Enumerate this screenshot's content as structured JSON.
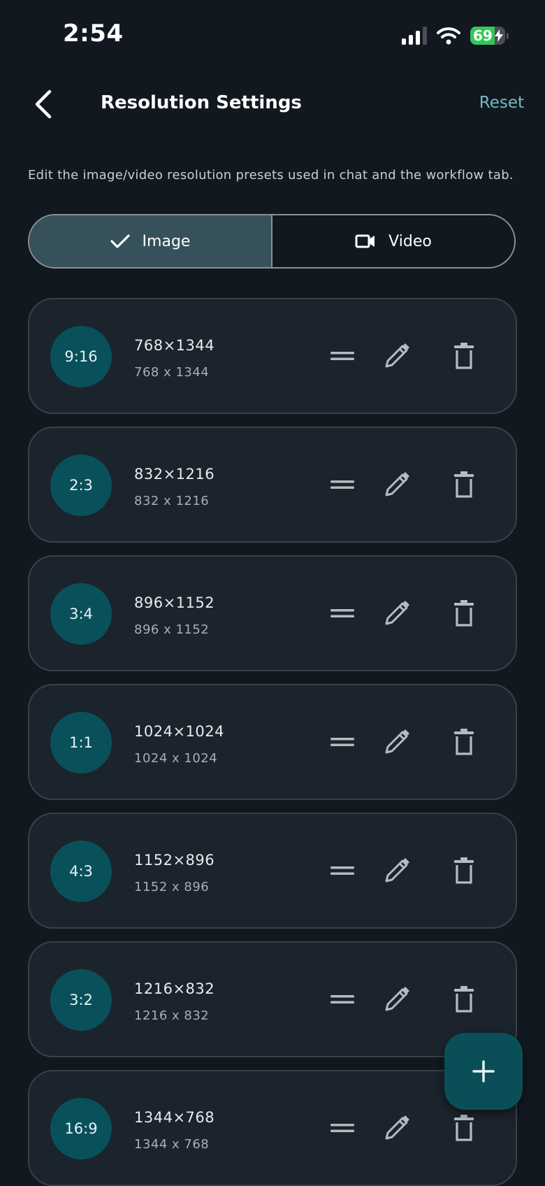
{
  "status_bar": {
    "time": "2:54",
    "battery": "69",
    "battery_level": 0.69,
    "battery_color": "#34c759"
  },
  "header": {
    "title": "Resolution Settings",
    "reset_label": "Reset",
    "back_icon": "chevron-left-icon"
  },
  "description": "Edit the image/video resolution presets used in chat and the workflow tab.",
  "tabs": [
    {
      "label": "Image",
      "icon": "check-icon",
      "selected": true
    },
    {
      "label": "Video",
      "icon": "video-camera-icon",
      "selected": false
    }
  ],
  "presets": [
    {
      "ratio": "9:16",
      "name": "768×1344",
      "size": "768 x 1344"
    },
    {
      "ratio": "2:3",
      "name": "832×1216",
      "size": "832 x 1216"
    },
    {
      "ratio": "3:4",
      "name": "896×1152",
      "size": "896 x 1152"
    },
    {
      "ratio": "1:1",
      "name": "1024×1024",
      "size": "1024 x 1024"
    },
    {
      "ratio": "4:3",
      "name": "1152×896",
      "size": "1152 x 896"
    },
    {
      "ratio": "3:2",
      "name": "1216×832",
      "size": "1216 x 832"
    },
    {
      "ratio": "16:9",
      "name": "1344×768",
      "size": "1344 x 768"
    }
  ],
  "row_actions": [
    "drag-handle-icon",
    "pencil-icon",
    "trash-icon"
  ],
  "fab": {
    "icon": "plus-icon"
  },
  "colors": {
    "accent": "#74b8c2",
    "circle": "#09515a",
    "selected_tab": "#36515a",
    "background": "#111820"
  }
}
